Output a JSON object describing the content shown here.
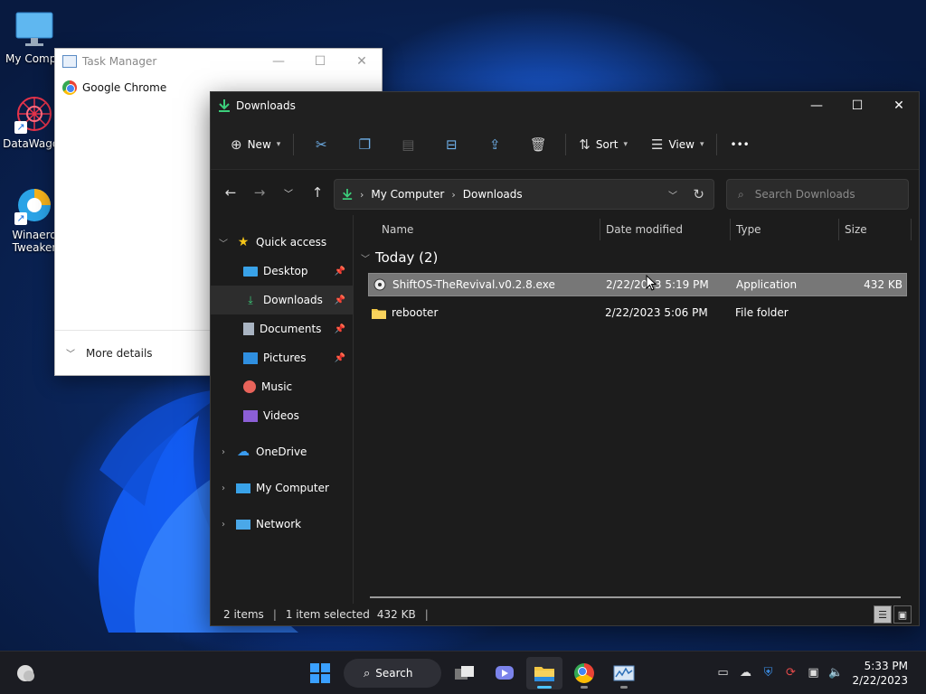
{
  "desktop": {
    "icons": [
      {
        "label": "My Compu",
        "icon": "monitor-icon"
      },
      {
        "label": "DataWagon",
        "icon": "datawagon-icon"
      },
      {
        "label": "Winaero Tweaker",
        "icon": "winaero-icon"
      }
    ]
  },
  "task_manager": {
    "title": "Task Manager",
    "processes": [
      {
        "name": "Google Chrome",
        "icon": "chrome-icon"
      }
    ],
    "more_details": "More details"
  },
  "explorer": {
    "title": "Downloads",
    "toolbar": {
      "new_label": "New",
      "sort_label": "Sort",
      "view_label": "View",
      "more_label": "•••"
    },
    "address": {
      "crumbs": [
        "My Computer",
        "Downloads"
      ]
    },
    "search_placeholder": "Search Downloads",
    "navpane": {
      "quick_access": "Quick access",
      "items": [
        {
          "label": "Desktop",
          "icon": "desktop-folder-icon",
          "pinned": true
        },
        {
          "label": "Downloads",
          "icon": "downloads-icon",
          "pinned": true,
          "selected": true
        },
        {
          "label": "Documents",
          "icon": "documents-icon",
          "pinned": true
        },
        {
          "label": "Pictures",
          "icon": "pictures-icon",
          "pinned": true
        },
        {
          "label": "Music",
          "icon": "music-icon",
          "pinned": false
        },
        {
          "label": "Videos",
          "icon": "videos-icon",
          "pinned": false
        }
      ],
      "onedrive": "OneDrive",
      "my_computer": "My Computer",
      "network": "Network"
    },
    "columns": {
      "name": "Name",
      "date_modified": "Date modified",
      "type": "Type",
      "size": "Size"
    },
    "group_label": "Today (2)",
    "files": [
      {
        "name": "ShiftOS-TheRevival.v0.2.8.exe",
        "date": "2/22/2023 5:19 PM",
        "type": "Application",
        "size": "432 KB",
        "selected": true,
        "icon": "exe-icon"
      },
      {
        "name": "rebooter",
        "date": "2/22/2023 5:06 PM",
        "type": "File folder",
        "size": "",
        "selected": false,
        "icon": "folder-icon"
      }
    ],
    "status": {
      "items": "2 items",
      "selected": "1 item selected",
      "size": "432 KB"
    }
  },
  "taskbar": {
    "search_label": "Search",
    "time": "5:33 PM",
    "date": "2/22/2023"
  }
}
